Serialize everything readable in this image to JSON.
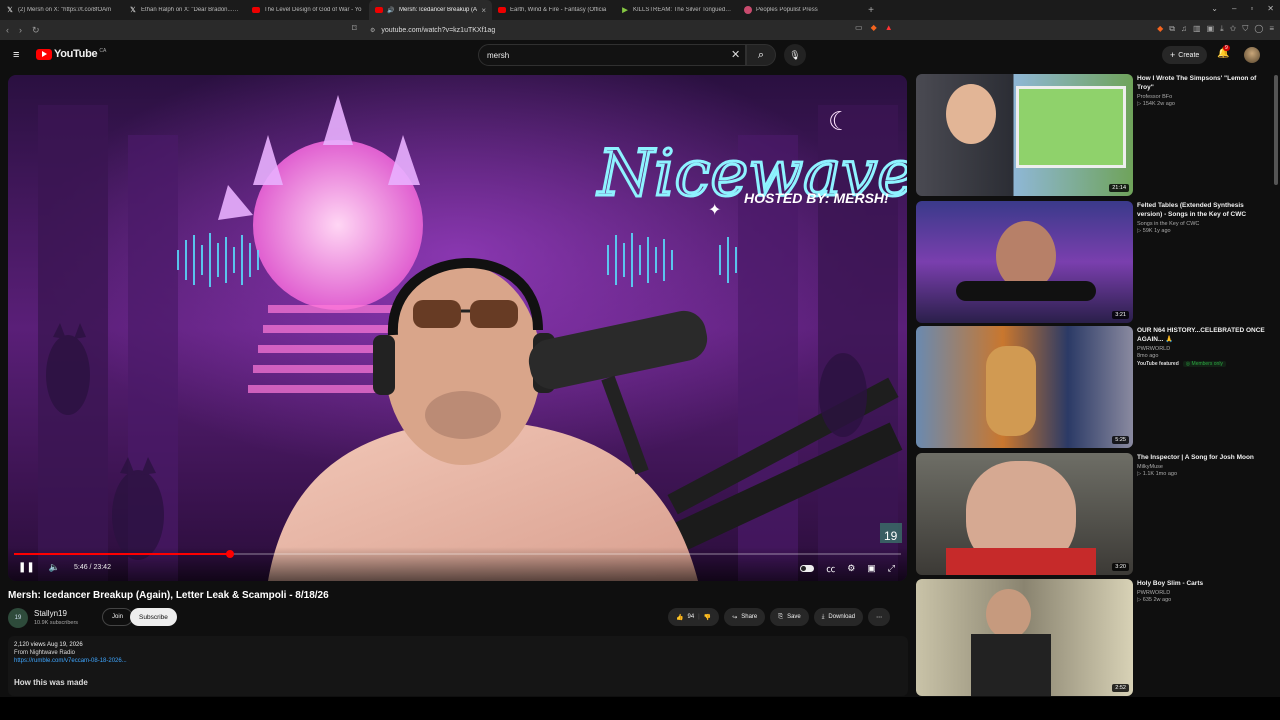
{
  "browser": {
    "tabs": [
      {
        "label": "(2) Mersh on X: \"https://t.co/8fOAm",
        "icon": "x-icon",
        "active": false
      },
      {
        "label": "Ethan Ralph on X: \"Dear Bradon...Sci",
        "icon": "x-icon",
        "active": false
      },
      {
        "label": "The Level Design of God of War - Yo",
        "icon": "youtube-icon",
        "active": false
      },
      {
        "label": "Mersh: Icedancer Breakup (A",
        "icon": "youtube-icon",
        "active": true
      },
      {
        "label": "Earth, Wind & Fire - Fantasy (Officia",
        "icon": "youtube-icon",
        "active": false
      },
      {
        "label": "KILLSTREAM: The Silver Tongued Dev",
        "icon": "rumble-icon",
        "active": false
      },
      {
        "label": "Peoples Populist Press",
        "icon": "press-icon",
        "active": false
      }
    ],
    "url": "youtube.com/watch?v=kz1uTKXf1ag"
  },
  "header": {
    "logo": "YouTube",
    "country": "CA",
    "search_value": "mersh",
    "create_label": "Create",
    "notif_count": "9"
  },
  "player": {
    "current_time": "5:46",
    "duration": "23:42",
    "progress": 0.243,
    "overlay_title": "Nicewave",
    "overlay_sub": "HOSTED BY: MERSH!",
    "corner_badge": "19"
  },
  "video": {
    "title": "Mersh: Icedancer Breakup (Again), Letter Leak & Scampoli - 8/18/26",
    "channel": "Stallyn19",
    "subscribers": "10.9K subscribers",
    "channel_avatar_text": "19",
    "join_label": "Join",
    "subscribe_label": "Subscribe",
    "likes": "94",
    "share_label": "Share",
    "save_label": "Save",
    "download_label": "Download",
    "views_date": "2,120 views  Aug 19, 2026",
    "from_line": "From Nightwave Radio",
    "link": "https://rumble.com/v7eccam-08-18-2026...",
    "section_heading": "How this was made"
  },
  "related": [
    {
      "title": "How I Wrote The Simpsons' \"Lemon of Troy\"",
      "channel": "Professor BFo",
      "stats": "154K  2w ago",
      "duration": "21:14",
      "badge1": "",
      "badge2": ""
    },
    {
      "title": "Felted Tables (Extended Synthesis version) - Songs in the Key of CWC",
      "channel": "Songs in the Key of CWC",
      "stats": "59K  1y ago",
      "duration": "3:21",
      "badge1": "",
      "badge2": ""
    },
    {
      "title": "OUR N64 HISTORY...CELEBRATED ONCE AGAIN... 🙏",
      "channel": "PWRWORLD",
      "stats": "8mo ago",
      "duration": "5:25",
      "badge1": "YouTube featured",
      "badge2": "Members only"
    },
    {
      "title": "The Inspector | A Song for Josh Moon",
      "channel": "MilkyMuse",
      "stats": "1.1K  1mo ago",
      "duration": "3:20",
      "badge1": "",
      "badge2": ""
    },
    {
      "title": "Holy Boy Slim - Carts",
      "channel": "PWRWORLD",
      "stats": "635  2w ago",
      "duration": "2:52",
      "badge1": "",
      "badge2": ""
    }
  ],
  "colors": {
    "accent": "#ff0000",
    "link": "#3ea6ff",
    "members": "#2ba640"
  }
}
